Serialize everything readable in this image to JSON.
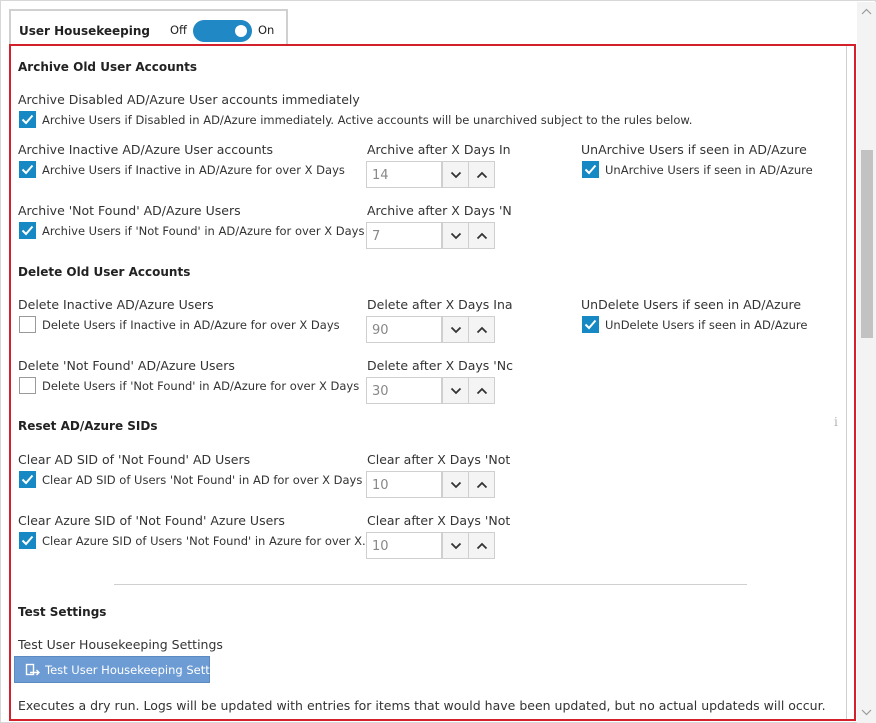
{
  "header": {
    "title": "User Housekeeping",
    "toggle_off": "Off",
    "toggle_on": "On",
    "toggle_state": "on"
  },
  "archive": {
    "section_title": "Archive Old User Accounts",
    "disabled_label": "Archive Disabled AD/Azure User accounts immediately",
    "disabled_checkbox": "Archive Users if Disabled in AD/Azure immediately. Active accounts will be unarchived subject to the rules below.",
    "disabled_checked": true,
    "inactive_label": "Archive Inactive AD/Azure User accounts",
    "inactive_checkbox": "Archive Users if Inactive in AD/Azure for over X Days",
    "inactive_checked": true,
    "inactive_days_label": "Archive after X Days In",
    "inactive_days": "14",
    "unarchive_label": "UnArchive Users if seen in AD/Azure",
    "unarchive_checkbox": "UnArchive Users if seen in AD/Azure",
    "unarchive_checked": true,
    "notfound_label": "Archive 'Not Found' AD/Azure Users",
    "notfound_checkbox": "Archive Users if 'Not Found' in AD/Azure for over X Days",
    "notfound_checked": true,
    "notfound_days_label": "Archive after X Days 'N",
    "notfound_days": "7"
  },
  "delete": {
    "section_title": "Delete Old User Accounts",
    "inactive_label": "Delete Inactive AD/Azure Users",
    "inactive_checkbox": "Delete Users if Inactive in AD/Azure for over X Days",
    "inactive_checked": false,
    "inactive_days_label": "Delete after X Days Ina",
    "inactive_days": "90",
    "undelete_label": "UnDelete Users if seen in AD/Azure",
    "undelete_checkbox": "UnDelete Users if seen in AD/Azure",
    "undelete_checked": true,
    "notfound_label": "Delete 'Not Found' AD/Azure Users",
    "notfound_checkbox": "Delete Users if 'Not Found' in AD/Azure for over X Days",
    "notfound_checked": false,
    "notfound_days_label": "Delete after X Days 'Nc",
    "notfound_days": "30"
  },
  "sids": {
    "section_title": "Reset AD/Azure SIDs",
    "ad_label": "Clear AD SID of 'Not Found' AD Users",
    "ad_checkbox": "Clear AD SID of Users 'Not Found' in AD for over X Days",
    "ad_checked": true,
    "ad_days_label": "Clear after X Days 'Not",
    "ad_days": "10",
    "azure_label": "Clear Azure SID of 'Not Found' Azure Users",
    "azure_checkbox": "Clear Azure SID of Users 'Not Found' in Azure for over X...",
    "azure_checked": true,
    "azure_days_label": "Clear after X Days 'Not",
    "azure_days": "10"
  },
  "test": {
    "section_title": "Test Settings",
    "label": "Test User Housekeeping Settings",
    "button": "Test User Housekeeping Setti",
    "note": "Executes a dry run. Logs will be updated with entries for items that would have been updated, but no actual updateds will occur."
  },
  "icons": {
    "info": "i",
    "spin_down": "chevron-down-icon",
    "spin_up": "chevron-up-icon",
    "test": "test-run-icon"
  },
  "colors": {
    "accent": "#1688c3",
    "toggle": "#1f88c5",
    "panel_border": "#d3202a",
    "test_button": "#6d9bd3"
  }
}
